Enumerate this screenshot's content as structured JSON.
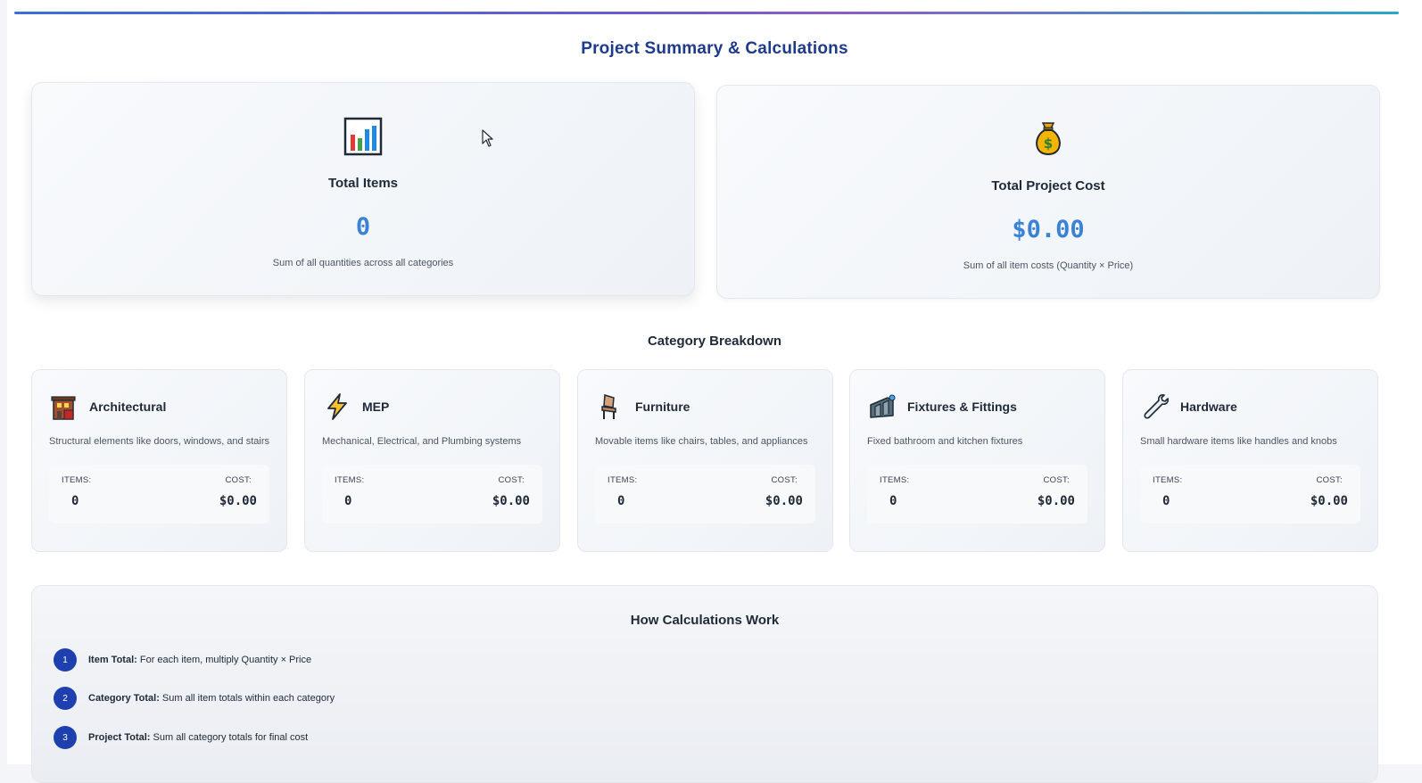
{
  "page": {
    "title": "Project Summary & Calculations"
  },
  "summary": {
    "total_items": {
      "icon": "bar-chart-icon",
      "label": "Total Items",
      "value": "0",
      "note": "Sum of all quantities across all categories"
    },
    "total_cost": {
      "icon": "money-bag-icon",
      "label": "Total Project Cost",
      "value": "$0.00",
      "note": "Sum of all item costs (Quantity × Price)"
    }
  },
  "breakdown": {
    "title": "Category Breakdown",
    "items_label": "ITEMS:",
    "cost_label": "COST:",
    "categories": [
      {
        "icon": "building-icon",
        "name": "Architectural",
        "desc": "Structural elements like doors, windows, and stairs",
        "items": "0",
        "cost": "$0.00"
      },
      {
        "icon": "lightning-icon",
        "name": "MEP",
        "desc": "Mechanical, Electrical, and Plumbing systems",
        "items": "0",
        "cost": "$0.00"
      },
      {
        "icon": "chair-icon",
        "name": "Furniture",
        "desc": "Movable items like chairs, tables, and appliances",
        "items": "0",
        "cost": "$0.00"
      },
      {
        "icon": "faucet-icon",
        "name": "Fixtures & Fittings",
        "desc": "Fixed bathroom and kitchen fixtures",
        "items": "0",
        "cost": "$0.00"
      },
      {
        "icon": "wrench-icon",
        "name": "Hardware",
        "desc": "Small hardware items like handles and knobs",
        "items": "0",
        "cost": "$0.00"
      }
    ]
  },
  "how": {
    "title": "How Calculations Work",
    "steps": [
      {
        "num": "1",
        "label": "Item Total:",
        "text": "For each item, multiply Quantity × Price"
      },
      {
        "num": "2",
        "label": "Category Total:",
        "text": "Sum all item totals within each category"
      },
      {
        "num": "3",
        "label": "Project Total:",
        "text": "Sum all category totals for final cost"
      }
    ]
  },
  "colors": {
    "accent": "#3b82d6",
    "title": "#1e3a8a",
    "step_badge": "#1e40af"
  }
}
